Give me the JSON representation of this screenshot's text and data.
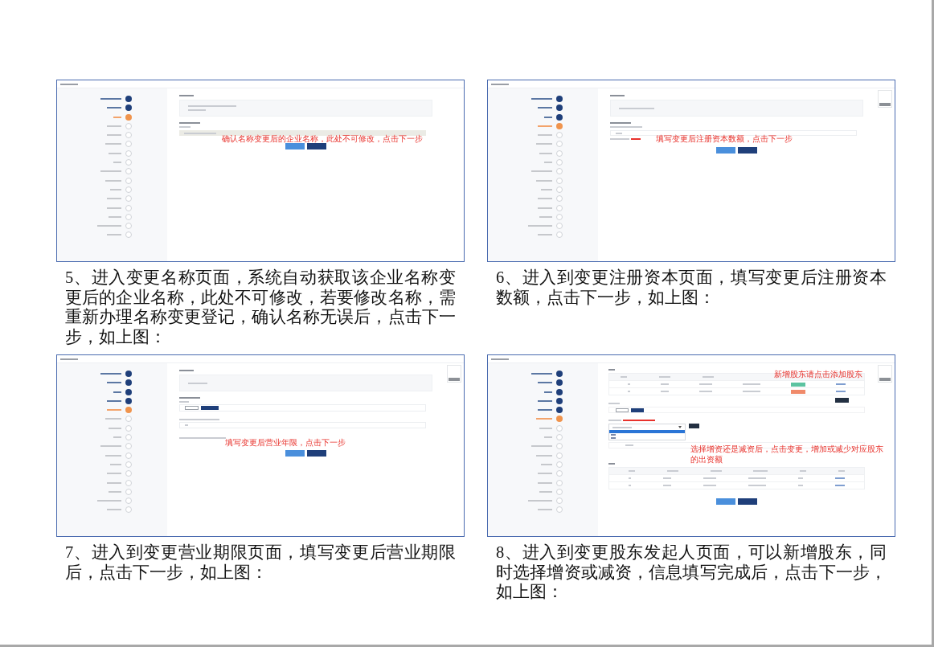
{
  "rows": [
    {
      "screenshots": [
        {
          "kind": "name",
          "annotations": [
            "确认名称变更后的企业名称，此处不可修改，点击下一步"
          ],
          "steps": [
            {
              "done": true,
              "current": false
            },
            {
              "done": true,
              "current": false
            },
            {
              "done": false,
              "current": true
            },
            {
              "done": false,
              "current": false
            },
            {
              "done": false,
              "current": false
            },
            {
              "done": false,
              "current": false
            },
            {
              "done": false,
              "current": false
            },
            {
              "done": false,
              "current": false
            },
            {
              "done": false,
              "current": false
            },
            {
              "done": false,
              "current": false
            },
            {
              "done": false,
              "current": false
            },
            {
              "done": false,
              "current": false
            },
            {
              "done": false,
              "current": false
            },
            {
              "done": false,
              "current": false
            },
            {
              "done": false,
              "current": false
            },
            {
              "done": false,
              "current": false
            }
          ],
          "caption": "5、进入变更名称页面，系统自动获取该企业名称变更后的企业名称，此处不可修改，若要修改名称，需重新办理名称变更登记，确认名称无误后，点击下一步，如上图："
        },
        {
          "kind": "capital",
          "annotations": [
            "填写变更后注册资本数额，点击下一步"
          ],
          "steps": [
            {
              "done": true,
              "current": false
            },
            {
              "done": true,
              "current": false
            },
            {
              "done": true,
              "current": false
            },
            {
              "done": false,
              "current": true
            },
            {
              "done": false,
              "current": false
            },
            {
              "done": false,
              "current": false
            },
            {
              "done": false,
              "current": false
            },
            {
              "done": false,
              "current": false
            },
            {
              "done": false,
              "current": false
            },
            {
              "done": false,
              "current": false
            },
            {
              "done": false,
              "current": false
            },
            {
              "done": false,
              "current": false
            },
            {
              "done": false,
              "current": false
            },
            {
              "done": false,
              "current": false
            },
            {
              "done": false,
              "current": false
            },
            {
              "done": false,
              "current": false
            }
          ],
          "caption": "6、进入到变更注册资本页面，填写变更后注册资本数额，点击下一步，如上图："
        }
      ]
    },
    {
      "screenshots": [
        {
          "kind": "term",
          "annotations": [
            "填写变更后营业年限，点击下一步"
          ],
          "steps": [
            {
              "done": true,
              "current": false
            },
            {
              "done": true,
              "current": false
            },
            {
              "done": true,
              "current": false
            },
            {
              "done": true,
              "current": false
            },
            {
              "done": false,
              "current": true
            },
            {
              "done": false,
              "current": false
            },
            {
              "done": false,
              "current": false
            },
            {
              "done": false,
              "current": false
            },
            {
              "done": false,
              "current": false
            },
            {
              "done": false,
              "current": false
            },
            {
              "done": false,
              "current": false
            },
            {
              "done": false,
              "current": false
            },
            {
              "done": false,
              "current": false
            },
            {
              "done": false,
              "current": false
            },
            {
              "done": false,
              "current": false
            },
            {
              "done": false,
              "current": false
            }
          ],
          "caption": "7、进入到变更营业期限页面，填写变更后营业期限后，点击下一步，如上图："
        },
        {
          "kind": "shareholder",
          "annotations": [
            "新增股东请点击添加股东",
            "选择增资还是减资后，点击变更，增加或减少对应股东的出资额"
          ],
          "steps": [
            {
              "done": true,
              "current": false
            },
            {
              "done": true,
              "current": false
            },
            {
              "done": true,
              "current": false
            },
            {
              "done": true,
              "current": false
            },
            {
              "done": true,
              "current": false
            },
            {
              "done": false,
              "current": true
            },
            {
              "done": false,
              "current": false
            },
            {
              "done": false,
              "current": false
            },
            {
              "done": false,
              "current": false
            },
            {
              "done": false,
              "current": false
            },
            {
              "done": false,
              "current": false
            },
            {
              "done": false,
              "current": false
            },
            {
              "done": false,
              "current": false
            },
            {
              "done": false,
              "current": false
            },
            {
              "done": false,
              "current": false
            },
            {
              "done": false,
              "current": false
            }
          ],
          "caption": "8、进入到变更股东发起人页面，可以新增股东，同时选择增资或减资，信息填写完成后，点击下一步，如上图："
        }
      ]
    }
  ]
}
